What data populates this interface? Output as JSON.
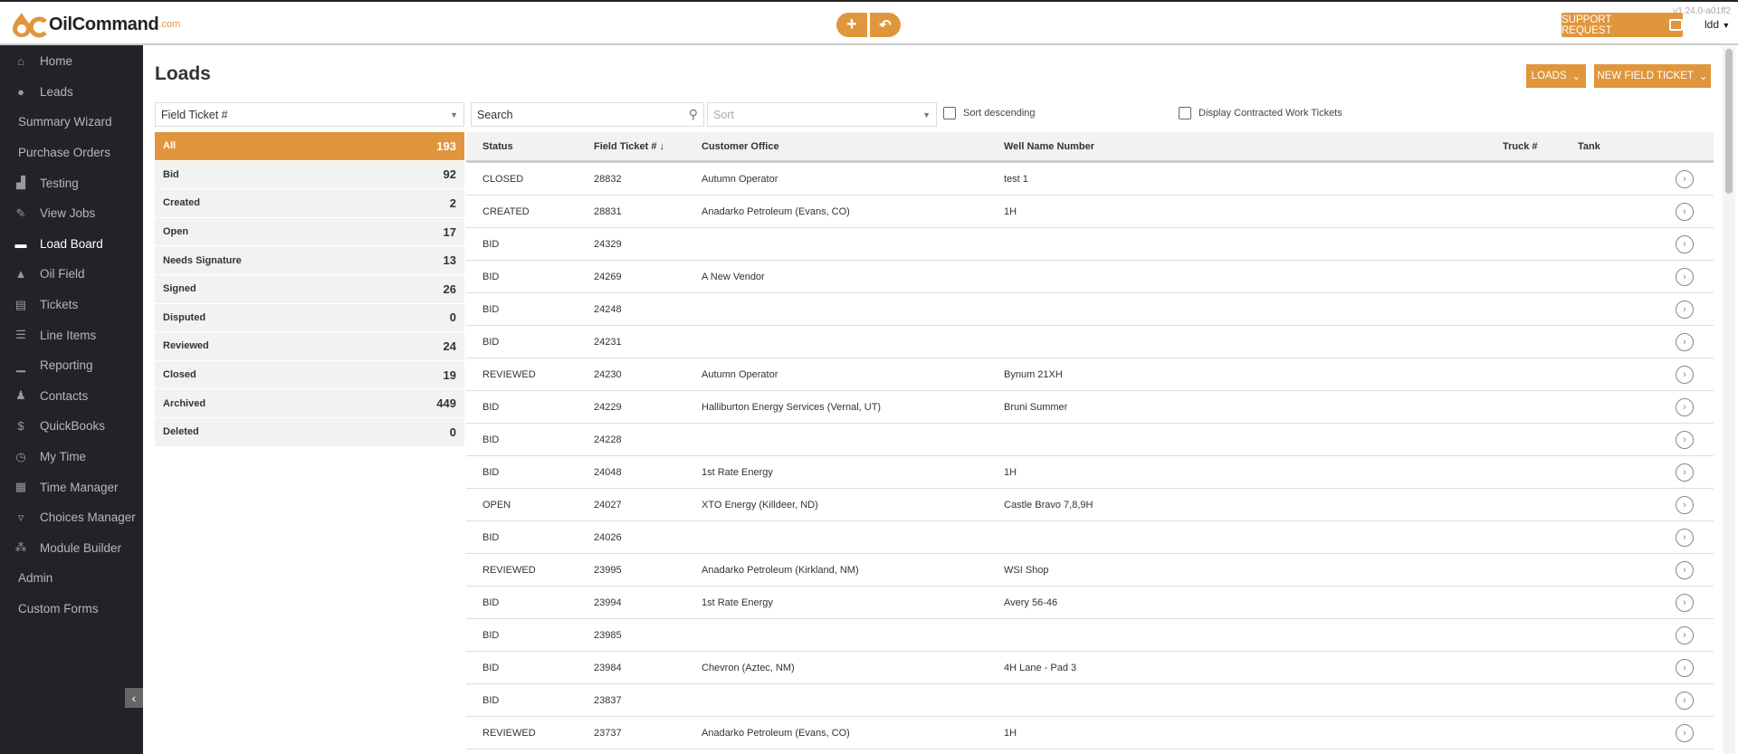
{
  "header": {
    "logo_text": "OilCommand",
    "logo_suffix": ".com",
    "version": "v1.24.0-a01ff2",
    "support_label": "SUPPORT REQUEST",
    "user": "ldd",
    "add_icon": "plus-icon",
    "undo_icon": "undo-icon"
  },
  "sidebar": {
    "items": [
      {
        "label": "Home",
        "icon": "home-icon",
        "glyph": "⌂"
      },
      {
        "label": "Leads",
        "icon": "lightbulb-dollar-icon",
        "glyph": "●"
      },
      {
        "label": "Summary Wizard"
      },
      {
        "label": "Purchase Orders"
      },
      {
        "label": "Testing",
        "icon": "testing-icon",
        "glyph": "▟"
      },
      {
        "label": "View Jobs",
        "icon": "tools-icon",
        "glyph": "✎"
      },
      {
        "label": "Load Board",
        "icon": "truck-icon",
        "glyph": "▬",
        "active": true
      },
      {
        "label": "Oil Field",
        "icon": "oil-derrick-icon",
        "glyph": "▲"
      },
      {
        "label": "Tickets",
        "icon": "ticket-icon",
        "glyph": "▤"
      },
      {
        "label": "Line Items",
        "icon": "list-icon",
        "glyph": "☰"
      },
      {
        "label": "Reporting",
        "icon": "chart-icon",
        "glyph": "▁"
      },
      {
        "label": "Contacts",
        "icon": "worker-icon",
        "glyph": "♟"
      },
      {
        "label": "QuickBooks",
        "icon": "dollar-icon",
        "glyph": "$"
      },
      {
        "label": "My Time",
        "icon": "clock-icon",
        "glyph": "◷"
      },
      {
        "label": "Time Manager",
        "icon": "calendar-icon",
        "glyph": "▦"
      },
      {
        "label": "Choices Manager",
        "icon": "dropdown-box-icon",
        "glyph": "▿"
      },
      {
        "label": "Module Builder",
        "icon": "cubes-icon",
        "glyph": "⁂"
      },
      {
        "label": "Admin"
      },
      {
        "label": "Custom Forms"
      }
    ]
  },
  "main": {
    "title": "Loads",
    "loads_button": "LOADS",
    "new_ticket_button": "NEW FIELD TICKET",
    "group_select": "Field Ticket #",
    "search_placeholder": "Search",
    "sort_placeholder": "Sort",
    "sort_descending": "Sort descending",
    "display_contracted": "Display Contracted Work Tickets",
    "status_filters": [
      {
        "label": "All",
        "count": "193",
        "active": true
      },
      {
        "label": "Bid",
        "count": "92"
      },
      {
        "label": "Created",
        "count": "2"
      },
      {
        "label": "Open",
        "count": "17"
      },
      {
        "label": "Needs Signature",
        "count": "13"
      },
      {
        "label": "Signed",
        "count": "26"
      },
      {
        "label": "Disputed",
        "count": "0"
      },
      {
        "label": "Reviewed",
        "count": "24"
      },
      {
        "label": "Closed",
        "count": "19"
      },
      {
        "label": "Archived",
        "count": "449"
      },
      {
        "label": "Deleted",
        "count": "0"
      }
    ],
    "columns": [
      "Status",
      "Field Ticket # ↓",
      "Customer Office",
      "Well Name Number",
      "Truck #",
      "Tank"
    ],
    "rows": [
      [
        "CLOSED",
        "28832",
        "Autumn Operator",
        "test 1"
      ],
      [
        "CREATED",
        "28831",
        "Anadarko Petroleum (Evans, CO)",
        "1H"
      ],
      [
        "BID",
        "24329",
        "",
        ""
      ],
      [
        "BID",
        "24269",
        "A New Vendor",
        ""
      ],
      [
        "BID",
        "24248",
        "",
        ""
      ],
      [
        "BID",
        "24231",
        "",
        ""
      ],
      [
        "REVIEWED",
        "24230",
        "Autumn Operator",
        "Bynum 21XH"
      ],
      [
        "BID",
        "24229",
        "Halliburton Energy Services (Vernal, UT)",
        "Bruni Summer"
      ],
      [
        "BID",
        "24228",
        "",
        ""
      ],
      [
        "BID",
        "24048",
        "1st Rate Energy",
        "1H"
      ],
      [
        "OPEN",
        "24027",
        "XTO Energy (Killdeer, ND)",
        "Castle Bravo 7,8,9H"
      ],
      [
        "BID",
        "24026",
        "",
        ""
      ],
      [
        "REVIEWED",
        "23995",
        "Anadarko Petroleum (Kirkland, NM)",
        "WSI Shop"
      ],
      [
        "BID",
        "23994",
        "1st Rate Energy",
        "Avery 56-46"
      ],
      [
        "BID",
        "23985",
        "",
        ""
      ],
      [
        "BID",
        "23984",
        "Chevron (Aztec, NM)",
        "4H Lane - Pad 3"
      ],
      [
        "BID",
        "23837",
        "",
        ""
      ],
      [
        "REVIEWED",
        "23737",
        "Anadarko Petroleum (Evans, CO)",
        "1H"
      ]
    ]
  },
  "colors": {
    "accent": "#e0963c",
    "sidebar": "#212327"
  }
}
